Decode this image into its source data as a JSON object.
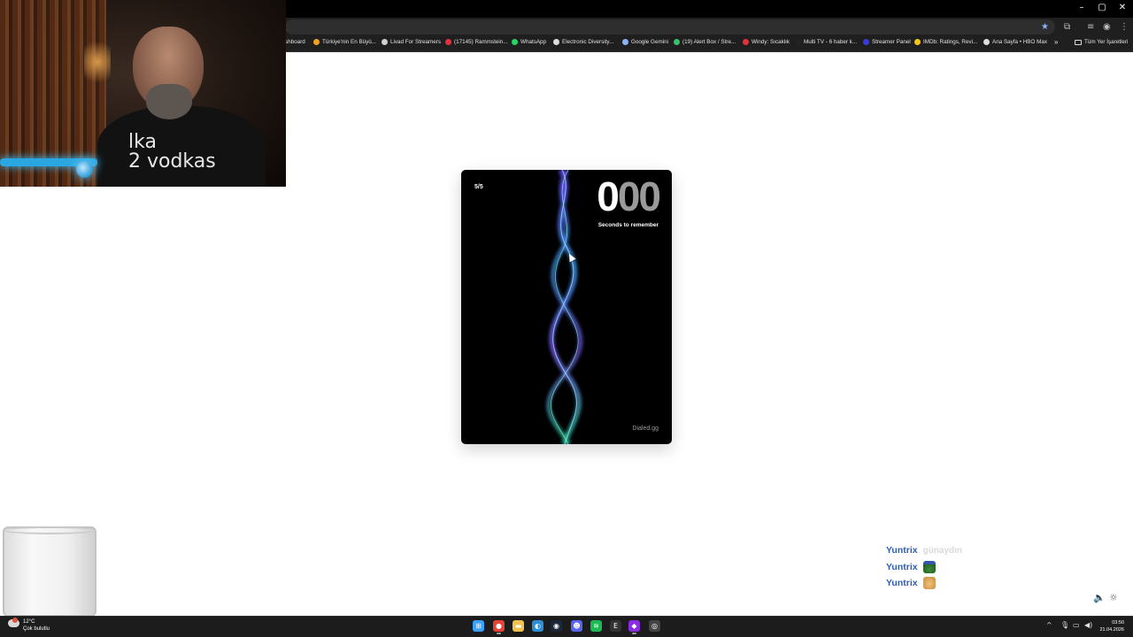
{
  "browser": {
    "window_controls": [
      "–",
      "▢",
      "✕"
    ],
    "bookmarks": [
      {
        "label": "shboard",
        "color": "#1f1f1f"
      },
      {
        "label": "Türkiye'nin En Büyü...",
        "color": "#f0a020"
      },
      {
        "label": "Livad For Streamers",
        "color": "#cfcfcf"
      },
      {
        "label": "(17145) Rammstein...",
        "color": "#e5303a"
      },
      {
        "label": "WhatsApp",
        "color": "#25d366"
      },
      {
        "label": "Electronic Diversity...",
        "color": "#dddddd"
      },
      {
        "label": "Google Gemini",
        "color": "#8ab4f8"
      },
      {
        "label": "(19) Alert Box / Stre...",
        "color": "#39c06a"
      },
      {
        "label": "Windy: Sıcaklık",
        "color": "#e5303a"
      },
      {
        "label": "Multi TV - 6 haber k...",
        "color": "#222222"
      },
      {
        "label": "Streamer Panel",
        "color": "#3a3ad8"
      },
      {
        "label": "IMDb: Ratings, Revi...",
        "color": "#f5c518"
      },
      {
        "label": "Ana Sayfa • HBO Max",
        "color": "#dddddd"
      }
    ],
    "more_bookmarks": "»",
    "all_bookmarks": "Tüm Yer İşaretleri"
  },
  "webcam": {
    "shirt_text": "lka\n2 vodkas"
  },
  "game": {
    "round": "5/5",
    "timer_first": "0",
    "timer_rest": "00",
    "timer_label": "Seconds to remember",
    "brand": "Dialed.gg"
  },
  "chat": [
    {
      "user": "Yuntrix",
      "message": "günaydın",
      "emote": ""
    },
    {
      "user": "Yuntrix",
      "message": "",
      "emote": "frog"
    },
    {
      "user": "Yuntrix",
      "message": "",
      "emote": "cat"
    }
  ],
  "taskbar": {
    "weather_temp": "12°C",
    "weather_desc": "Çok bulutlu",
    "apps": [
      {
        "name": "windows-start",
        "glyph": "⊞",
        "color": "#3aa0ff"
      },
      {
        "name": "chrome",
        "glyph": "●",
        "color": "#e94235"
      },
      {
        "name": "file-explorer",
        "glyph": "▬",
        "color": "#f2c14e"
      },
      {
        "name": "edge",
        "glyph": "◐",
        "color": "#2a8fd8"
      },
      {
        "name": "steam",
        "glyph": "◉",
        "color": "#1b2838"
      },
      {
        "name": "discord",
        "glyph": "☻",
        "color": "#5865f2"
      },
      {
        "name": "spotify",
        "glyph": "≋",
        "color": "#1db954"
      },
      {
        "name": "epic-games",
        "glyph": "E",
        "color": "#333333"
      },
      {
        "name": "streamer-app",
        "glyph": "◆",
        "color": "#8a2be2"
      },
      {
        "name": "obs",
        "glyph": "◎",
        "color": "#444444"
      }
    ],
    "tray_arrow": "^",
    "clock_time": "03:50",
    "clock_date": "21.04.2026"
  }
}
